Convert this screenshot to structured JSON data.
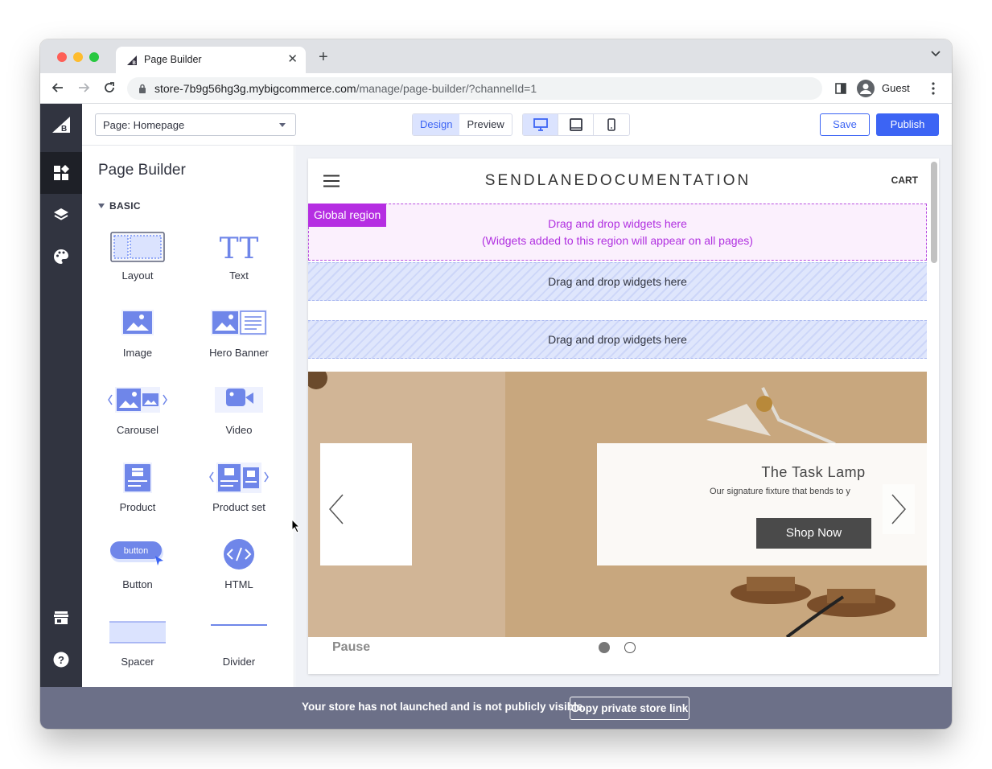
{
  "browser": {
    "tab_title": "Page Builder",
    "tab_close": "✕",
    "new_tab": "+",
    "url_host": "store-7b9g56hg3g.mybigcommerce.com",
    "url_path": "/manage/page-builder/?channelId=1",
    "profile_name": "Guest"
  },
  "topbar": {
    "page_select": "Page: Homepage",
    "mode_design": "Design",
    "mode_preview": "Preview",
    "save": "Save",
    "publish": "Publish"
  },
  "panel": {
    "title": "Page Builder",
    "section": "BASIC",
    "widgets": [
      {
        "label": "Layout"
      },
      {
        "label": "Text"
      },
      {
        "label": "Image"
      },
      {
        "label": "Hero Banner"
      },
      {
        "label": "Carousel"
      },
      {
        "label": "Video"
      },
      {
        "label": "Product"
      },
      {
        "label": "Product set"
      },
      {
        "label": "Button",
        "icon_text": "button"
      },
      {
        "label": "HTML"
      },
      {
        "label": "Spacer"
      },
      {
        "label": "Divider"
      }
    ],
    "text_icon": "TT"
  },
  "store": {
    "brand": "SENDLANEDOCUMENTATION",
    "cart": "CART",
    "global_region": {
      "tag": "Global region",
      "line1": "Drag and drop widgets here",
      "line2": "(Widgets added to this region will appear on all pages)"
    },
    "dropzone1": "Drag and drop widgets here",
    "dropzone2": "Drag and drop widgets here",
    "hero": {
      "title": "The Task Lamp",
      "subtitle": "Our signature fixture that bends to y",
      "button": "Shop Now"
    },
    "pause": "Pause"
  },
  "notice": {
    "message": "Your store has not launched and is not publicly visible.",
    "copy_link": "Copy private store link"
  },
  "colors": {
    "accent": "#3c64f4",
    "rail": "#313440",
    "global_region": "#b52ee2",
    "banner": "#6c7088"
  }
}
